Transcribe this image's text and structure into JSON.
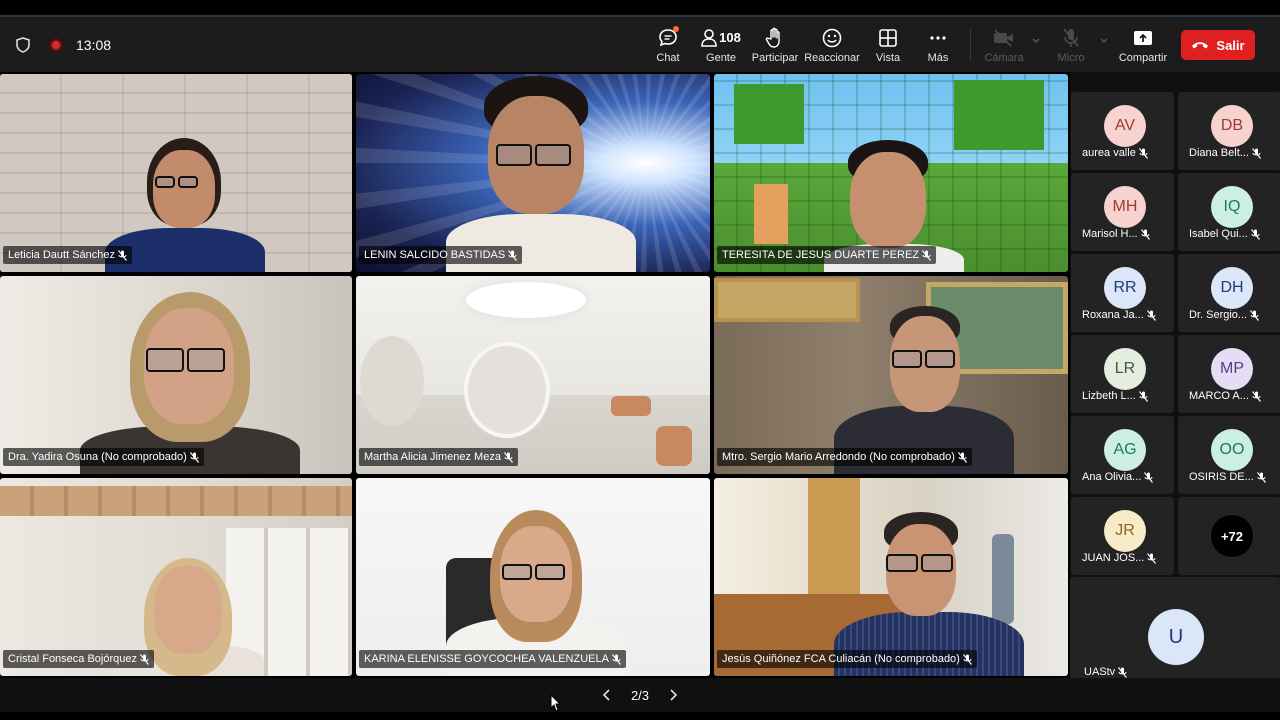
{
  "status": {
    "time": "13:08"
  },
  "toolbar": {
    "chat": "Chat",
    "people": "Gente",
    "people_count": "108",
    "participate": "Participar",
    "react": "Reaccionar",
    "view": "Vista",
    "more": "Más",
    "camera": "Cámara",
    "mic": "Micro",
    "share": "Compartir",
    "leave": "Salir"
  },
  "tiles": [
    {
      "name": "Leticia Dautt Sánchez"
    },
    {
      "name": "LENIN SALCIDO BASTIDAS"
    },
    {
      "name": "TERESITA DE JESUS DUARTE PEREZ"
    },
    {
      "name": "Dra. Yadira Osuna (No comprobado)"
    },
    {
      "name": "Martha Alicia Jimenez Meza"
    },
    {
      "name": "Mtro. Sergio Mario Arredondo (No comprobado)"
    },
    {
      "name": "Cristal Fonseca Bojórquez"
    },
    {
      "name": "KARINA ELENISSE GOYCOCHEA VALENZUELA"
    },
    {
      "name": "Jesús Quiñónez FCA Culiacán (No comprobado)"
    }
  ],
  "participants": [
    {
      "initials": "AV",
      "name": "aurea valle",
      "bg": "#f6d3cf",
      "fg": "#a03a36"
    },
    {
      "initials": "DB",
      "name": "Diana Belt...",
      "bg": "#f6d3cf",
      "fg": "#a03a36"
    },
    {
      "initials": "MH",
      "name": "Marisol H...",
      "bg": "#f6d3cf",
      "fg": "#a03a36"
    },
    {
      "initials": "IQ",
      "name": "Isabel Qui...",
      "bg": "#cdeee2",
      "fg": "#1c7a5a"
    },
    {
      "initials": "RR",
      "name": "Roxana Ja...",
      "bg": "#dbe6f8",
      "fg": "#1d3a76"
    },
    {
      "initials": "DH",
      "name": "Dr. Sergio...",
      "bg": "#dbe6f8",
      "fg": "#1d3a76"
    },
    {
      "initials": "LR",
      "name": "Lizbeth L...",
      "bg": "#e4ede0",
      "fg": "#3d5a34"
    },
    {
      "initials": "MP",
      "name": "MARCO A...",
      "bg": "#e6dcf4",
      "fg": "#5a3a8a"
    },
    {
      "initials": "AG",
      "name": "Ana Olivia...",
      "bg": "#cdeee2",
      "fg": "#1c7a5a"
    },
    {
      "initials": "OO",
      "name": "OSIRIS DE...",
      "bg": "#cdeee2",
      "fg": "#1c7a5a"
    },
    {
      "initials": "JR",
      "name": "JUAN JOS...",
      "bg": "#f8ebc8",
      "fg": "#8a6a1a"
    }
  ],
  "more_participants": "+72",
  "featured_participant": {
    "initials": "U",
    "name": "UAStv"
  },
  "pager": {
    "page": "2/3"
  }
}
